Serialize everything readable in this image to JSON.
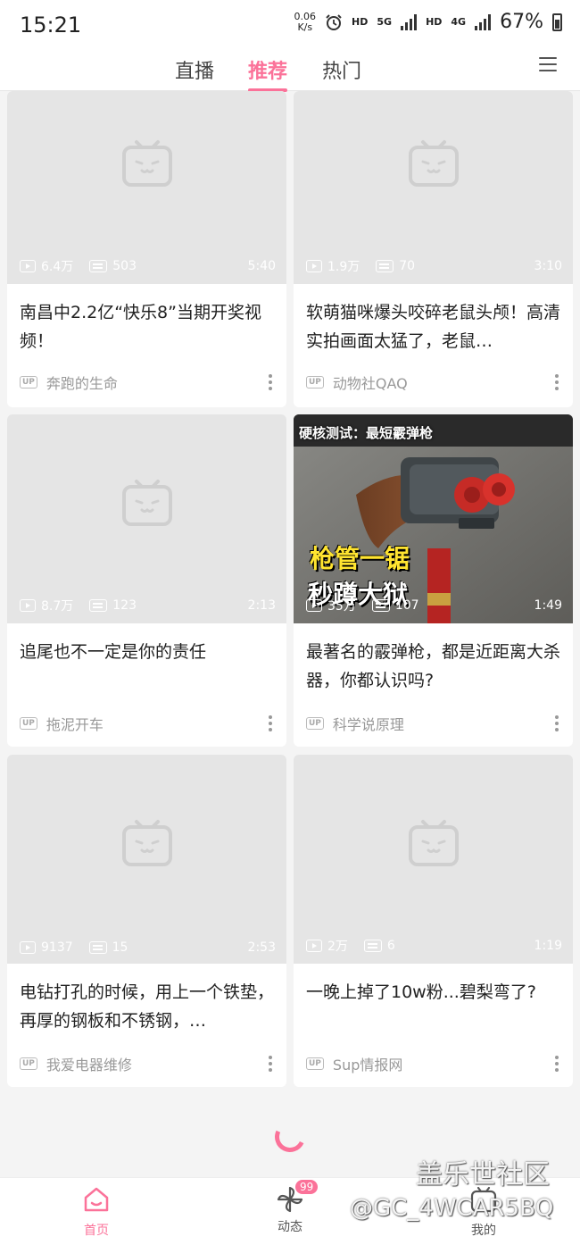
{
  "status_bar": {
    "time": "15:21",
    "net_speed_value": "0.06",
    "net_speed_unit": "K/s",
    "hd1": "HD",
    "net1": "5G",
    "hd2": "HD",
    "net2": "4G",
    "battery": "67%"
  },
  "top_nav": {
    "tabs": [
      {
        "label": "直播"
      },
      {
        "label": "推荐",
        "active": true
      },
      {
        "label": "热门"
      }
    ],
    "menu_icon": "menu-icon"
  },
  "feed": {
    "cards": [
      {
        "views": "6.4万",
        "danmaku": "503",
        "duration": "5:40",
        "title": "南昌中2.2亿“快乐8”当期开奖视频！",
        "uploader": "奔跑的生命",
        "up_badge": "UP"
      },
      {
        "views": "1.9万",
        "danmaku": "70",
        "duration": "3:10",
        "title": "软萌猫咪爆头咬碎老鼠头颅！高清实拍画面太猛了，老鼠…",
        "uploader": "动物社QAQ",
        "up_badge": "UP"
      },
      {
        "views": "8.7万",
        "danmaku": "123",
        "duration": "2:13",
        "title": "追尾也不一定是你的责任",
        "uploader": "拖泥开车",
        "up_badge": "UP"
      },
      {
        "views": "35万",
        "danmaku": "107",
        "duration": "1:49",
        "title": "最著名的霰弹枪，都是近距离大杀器，你都认识吗?",
        "uploader": "科学说原理",
        "up_badge": "UP",
        "thumb_caption": "硬核测试：最短霰弹枪",
        "thumb_text_1": "枪管一锯",
        "thumb_text_2": "秒蹲大狱"
      },
      {
        "views": "9137",
        "danmaku": "15",
        "duration": "2:53",
        "title": "电钻打孔的时候，用上一个铁垫，再厚的钢板和不锈钢，…",
        "uploader": "我爱电器维修",
        "up_badge": "UP"
      },
      {
        "views": "2万",
        "danmaku": "6",
        "duration": "1:19",
        "title": "一晚上掉了10w粉...碧梨弯了?",
        "uploader": "Sup情报网",
        "up_badge": "UP"
      }
    ]
  },
  "bottom_bar": {
    "items": [
      {
        "label": "首页",
        "icon": "home-icon",
        "active": true
      },
      {
        "label": "动态",
        "icon": "pinwheel-icon",
        "badge": "99"
      },
      {
        "label": "我的",
        "icon": "tv-icon"
      }
    ]
  },
  "watermark": {
    "line1": "盖乐世社区",
    "line2": "@GC_4WCAR5BQ"
  },
  "colors": {
    "accent": "#fb7299",
    "placeholder": "#e5e5e5",
    "background": "#f4f4f4"
  }
}
